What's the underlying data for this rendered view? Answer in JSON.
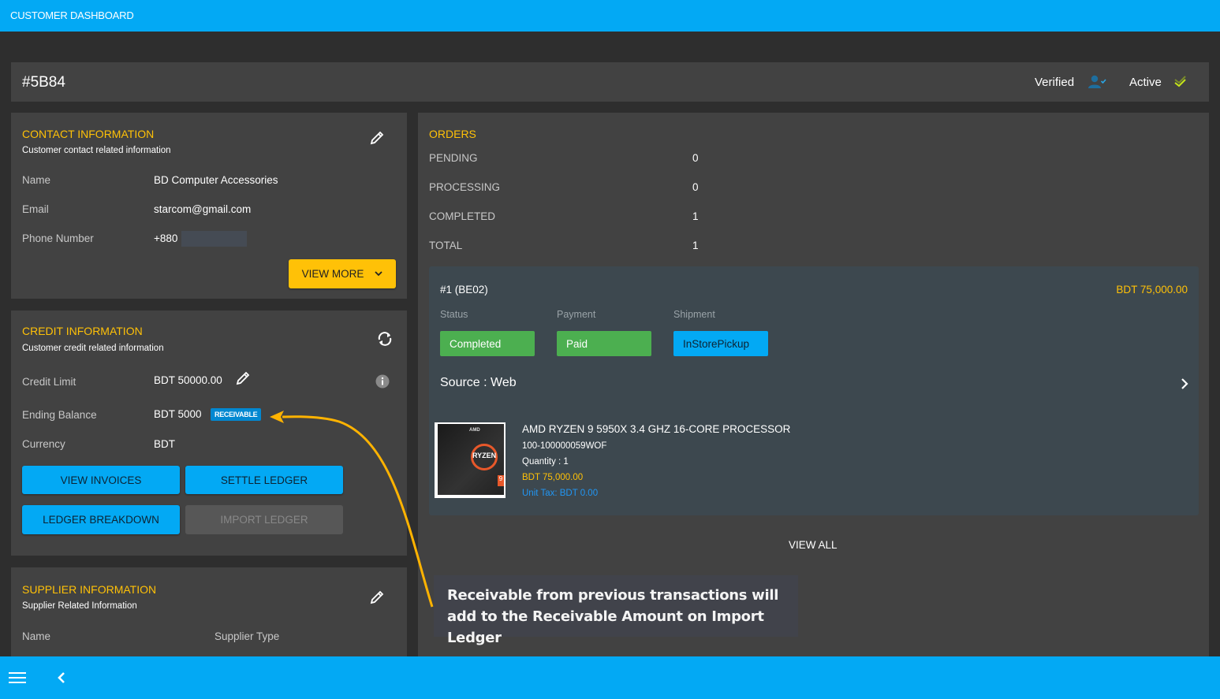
{
  "app": {
    "title": "CUSTOMER DASHBOARD"
  },
  "header": {
    "customer_id": "#5B84",
    "verified_label": "Verified",
    "active_label": "Active",
    "colors": {
      "verified_icon": "#1e88c7",
      "active_icon": "#c6e619"
    }
  },
  "contact": {
    "title": "CONTACT INFORMATION",
    "subtitle": "Customer contact related information",
    "fields": [
      {
        "label": "Name",
        "value": "BD Computer Accessories"
      },
      {
        "label": "Email",
        "value": "starcom@gmail.com"
      },
      {
        "label": "Phone Number",
        "value": "+880"
      }
    ],
    "view_more_label": "VIEW MORE"
  },
  "credit": {
    "title": "CREDIT INFORMATION",
    "subtitle": "Customer credit related information",
    "credit_limit_label": "Credit Limit",
    "credit_limit_value": "BDT 50000.00",
    "ending_balance_label": "Ending Balance",
    "ending_balance_value": "BDT 5000",
    "ending_balance_badge": "RECEIVABLE",
    "currency_label": "Currency",
    "currency_value": "BDT",
    "buttons": {
      "view_invoices": "VIEW INVOICES",
      "settle_ledger": "SETTLE LEDGER",
      "ledger_breakdown": "LEDGER BREAKDOWN",
      "import_ledger": "IMPORT LEDGER"
    }
  },
  "supplier": {
    "title": "SUPPLIER INFORMATION",
    "subtitle": "Supplier Related Information",
    "name_label": "Name",
    "type_label": "Supplier Type"
  },
  "orders": {
    "title": "ORDERS",
    "stats": [
      {
        "label": "PENDING",
        "value": "0"
      },
      {
        "label": "PROCESSING",
        "value": "0"
      },
      {
        "label": "COMPLETED",
        "value": "1"
      },
      {
        "label": "TOTAL",
        "value": "1"
      }
    ],
    "order": {
      "id": "#1 (BE02)",
      "amount": "BDT 75,000.00",
      "status_label": "Status",
      "status_value": "Completed",
      "payment_label": "Payment",
      "payment_value": "Paid",
      "shipment_label": "Shipment",
      "shipment_value": "InStorePickup",
      "source": "Source : Web",
      "item": {
        "name": "AMD RYZEN 9 5950X 3.4 GHZ 16-CORE PROCESSOR",
        "sku": "100-100000059WOF",
        "quantity": "Quantity : 1",
        "price": "BDT 75,000.00",
        "unit_tax": "Unit Tax: BDT 0.00",
        "image_brand": "AMD",
        "image_text": "RYZEN",
        "image_tier": "9"
      }
    },
    "view_all_label": "VIEW ALL"
  },
  "annotation": {
    "text": "Receivable from previous transactions will add to the Receivable Amount on Import Ledger",
    "arrow_color": "#ffb300"
  }
}
